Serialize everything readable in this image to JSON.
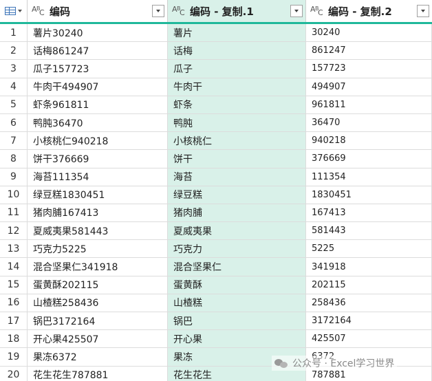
{
  "columns": [
    {
      "title": "编码"
    },
    {
      "title": "编码 - 复制.1"
    },
    {
      "title": "编码 - 复制.2"
    }
  ],
  "rows": [
    {
      "n": "1",
      "c1": "薯片30240",
      "c2": "薯片",
      "c3": "30240"
    },
    {
      "n": "2",
      "c1": "话梅861247",
      "c2": "话梅",
      "c3": "861247"
    },
    {
      "n": "3",
      "c1": "瓜子157723",
      "c2": "瓜子",
      "c3": "157723"
    },
    {
      "n": "4",
      "c1": "牛肉干494907",
      "c2": "牛肉干",
      "c3": "494907"
    },
    {
      "n": "5",
      "c1": "虾条961811",
      "c2": "虾条",
      "c3": "961811"
    },
    {
      "n": "6",
      "c1": "鸭肫36470",
      "c2": "鸭肫",
      "c3": "36470"
    },
    {
      "n": "7",
      "c1": "小核桃仁940218",
      "c2": "小核桃仁",
      "c3": "940218"
    },
    {
      "n": "8",
      "c1": "饼干376669",
      "c2": "饼干",
      "c3": "376669"
    },
    {
      "n": "9",
      "c1": "海苔111354",
      "c2": "海苔",
      "c3": "111354"
    },
    {
      "n": "10",
      "c1": "绿豆糕1830451",
      "c2": "绿豆糕",
      "c3": "1830451"
    },
    {
      "n": "11",
      "c1": "猪肉脯167413",
      "c2": "猪肉脯",
      "c3": "167413"
    },
    {
      "n": "12",
      "c1": "夏威夷果581443",
      "c2": "夏威夷果",
      "c3": "581443"
    },
    {
      "n": "13",
      "c1": "巧克力5225",
      "c2": "巧克力",
      "c3": "5225"
    },
    {
      "n": "14",
      "c1": "混合坚果仁341918",
      "c2": "混合坚果仁",
      "c3": "341918"
    },
    {
      "n": "15",
      "c1": "蛋黄酥202115",
      "c2": "蛋黄酥",
      "c3": "202115"
    },
    {
      "n": "16",
      "c1": "山楂糕258436",
      "c2": "山楂糕",
      "c3": "258436"
    },
    {
      "n": "17",
      "c1": "锅巴3172164",
      "c2": "锅巴",
      "c3": "3172164"
    },
    {
      "n": "18",
      "c1": "开心果425507",
      "c2": "开心果",
      "c3": "425507"
    },
    {
      "n": "19",
      "c1": "果冻6372",
      "c2": "果冻",
      "c3": "6372"
    },
    {
      "n": "20",
      "c1": "花生花生787881",
      "c2": "花生花生",
      "c3": "787881"
    }
  ],
  "watermark": {
    "text": "公众号 · Excel学习世界"
  },
  "colors": {
    "accent": "#1fb89a",
    "selected_column": "#d9f1e9"
  }
}
